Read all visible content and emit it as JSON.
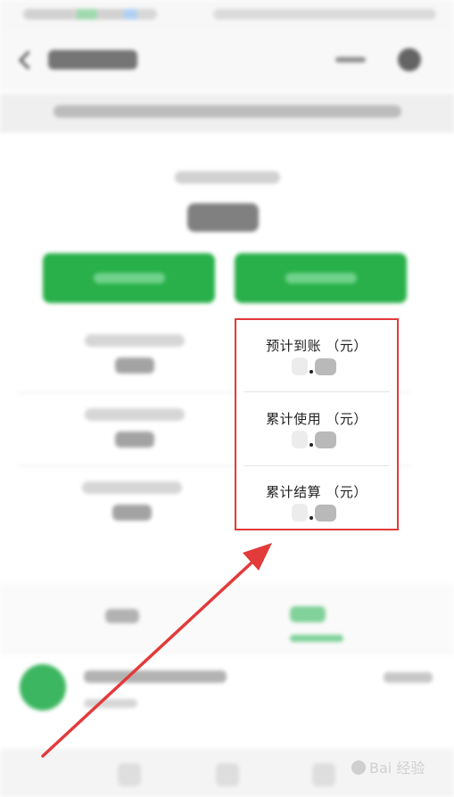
{
  "popover": {
    "items": [
      {
        "label": "预计到账 （元）",
        "value": "."
      },
      {
        "label": "累计使用 （元）",
        "value": "."
      },
      {
        "label": "累计结算 （元）",
        "value": "."
      }
    ]
  },
  "colors": {
    "highlight_border": "#e33a3a",
    "arrow": "#e33a3a",
    "primary_green": "#29b04a"
  },
  "watermark": {
    "text": "Bai 经验"
  }
}
